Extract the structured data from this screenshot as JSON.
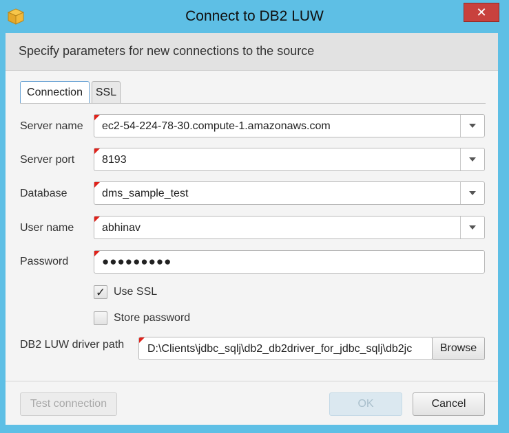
{
  "window": {
    "title": "Connect to DB2 LUW",
    "close_label": "✕",
    "app_icon": "box-icon"
  },
  "banner": {
    "text": "Specify parameters for new connections to the source"
  },
  "tabs": [
    {
      "label": "Connection",
      "active": true
    },
    {
      "label": "SSL",
      "active": false
    }
  ],
  "form": {
    "server_name": {
      "label": "Server name",
      "value": "ec2-54-224-78-30.compute-1.amazonaws.com"
    },
    "server_port": {
      "label": "Server port",
      "value": "8193"
    },
    "database": {
      "label": "Database",
      "value": "dms_sample_test"
    },
    "user_name": {
      "label": "User name",
      "value": "abhinav"
    },
    "password": {
      "label": "Password",
      "value": "●●●●●●●●●"
    },
    "use_ssl": {
      "label": "Use SSL",
      "checked": true
    },
    "store_password": {
      "label": "Store password",
      "checked": false
    },
    "driver_path": {
      "label": "DB2 LUW driver path",
      "value": "D:\\Clients\\jdbc_sqlj\\db2_db2driver_for_jdbc_sqlj\\db2jc",
      "browse_label": "Browse"
    }
  },
  "footer": {
    "test_connection_label": "Test connection",
    "ok_label": "OK",
    "cancel_label": "Cancel"
  },
  "colors": {
    "title_bar": "#5ebfe5",
    "close_button": "#c8413d",
    "required_marker": "#e0221b",
    "active_tab_border": "#6aa3d3"
  }
}
